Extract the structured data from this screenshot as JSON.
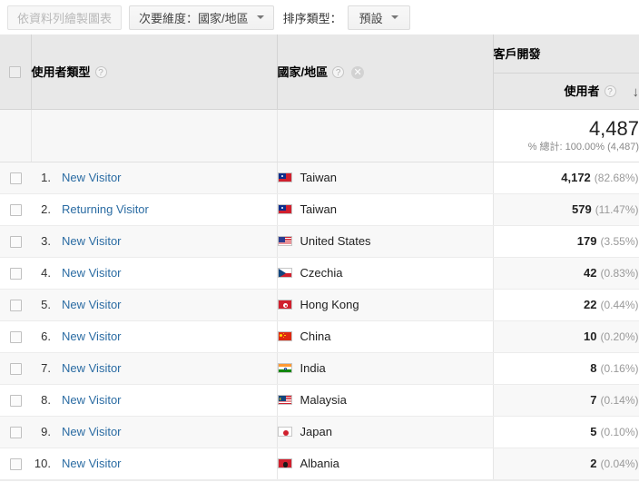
{
  "toolbar": {
    "plot_rows_label": "依資料列繪製圖表",
    "secondary_dimension_label": "次要維度：國家/地區",
    "sort_type_label": "排序類型：",
    "sort_type_value": "預設"
  },
  "table": {
    "headers": {
      "dimension1": "使用者類型",
      "dimension2": "國家/地區",
      "metric_group": "客戶開發",
      "metric": "使用者",
      "help_icon": "?",
      "remove_icon": "✕",
      "sort_icon": "↓"
    },
    "totals": {
      "value": "4,487",
      "subtext": "% 總計: 100.00% (4,487)"
    },
    "rows": [
      {
        "index": "1.",
        "user_type": "New Visitor",
        "country": "Taiwan",
        "flag": "tw",
        "users": "4,172",
        "percent": "(82.68%)"
      },
      {
        "index": "2.",
        "user_type": "Returning Visitor",
        "country": "Taiwan",
        "flag": "tw",
        "users": "579",
        "percent": "(11.47%)"
      },
      {
        "index": "3.",
        "user_type": "New Visitor",
        "country": "United States",
        "flag": "us",
        "users": "179",
        "percent": "(3.55%)"
      },
      {
        "index": "4.",
        "user_type": "New Visitor",
        "country": "Czechia",
        "flag": "cz",
        "users": "42",
        "percent": "(0.83%)"
      },
      {
        "index": "5.",
        "user_type": "New Visitor",
        "country": "Hong Kong",
        "flag": "hk",
        "users": "22",
        "percent": "(0.44%)"
      },
      {
        "index": "6.",
        "user_type": "New Visitor",
        "country": "China",
        "flag": "cn",
        "users": "10",
        "percent": "(0.20%)"
      },
      {
        "index": "7.",
        "user_type": "New Visitor",
        "country": "India",
        "flag": "in",
        "users": "8",
        "percent": "(0.16%)"
      },
      {
        "index": "8.",
        "user_type": "New Visitor",
        "country": "Malaysia",
        "flag": "my",
        "users": "7",
        "percent": "(0.14%)"
      },
      {
        "index": "9.",
        "user_type": "New Visitor",
        "country": "Japan",
        "flag": "jp",
        "users": "5",
        "percent": "(0.10%)"
      },
      {
        "index": "10.",
        "user_type": "New Visitor",
        "country": "Albania",
        "flag": "al",
        "users": "2",
        "percent": "(0.04%)"
      }
    ]
  },
  "colors": {
    "link": "#2b6ca3",
    "header_bg": "#e8e8e8",
    "row_alt_bg": "#f8f8f8",
    "muted_text": "#999999"
  }
}
